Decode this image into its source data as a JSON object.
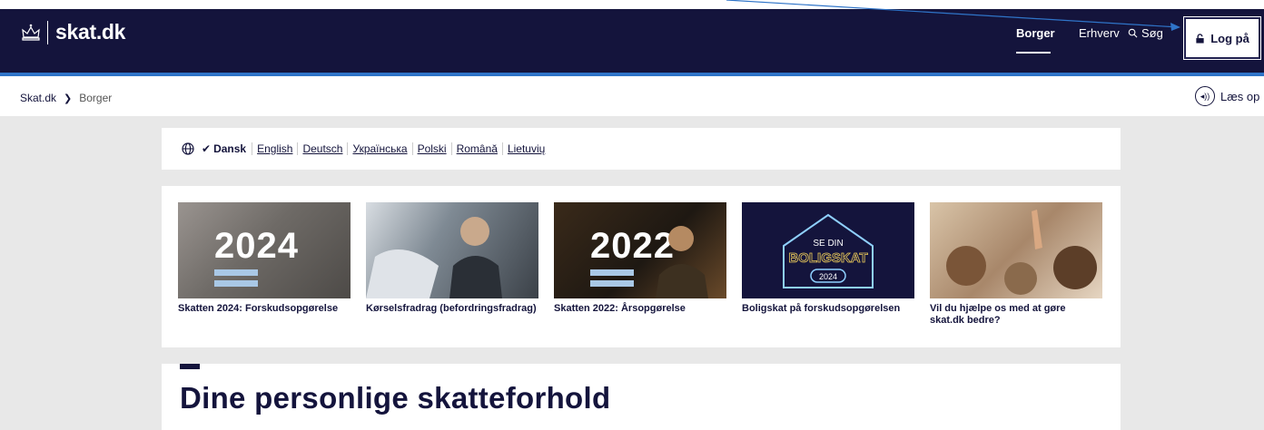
{
  "header": {
    "logo_text": "skat.dk",
    "nav": {
      "borger": "Borger",
      "erhverv": "Erhverv",
      "search": "Søg"
    },
    "login_label": "Log på"
  },
  "breadcrumb": {
    "home": "Skat.dk",
    "separator": "❯",
    "current": "Borger"
  },
  "read_aloud": {
    "icon_glyph": "◂))",
    "label": "Læs op"
  },
  "languages": {
    "active": "Dansk",
    "items": [
      "English",
      "Deutsch",
      "Українська",
      "Polski",
      "Română",
      "Lietuvių"
    ]
  },
  "cards": [
    {
      "caption": "Skatten 2024: Forskudsopgørelse",
      "overlay": "2024"
    },
    {
      "caption": "Kørselsfradrag (befordringsfradrag)"
    },
    {
      "caption": "Skatten 2022: Årsopgørelse",
      "overlay": "2022"
    },
    {
      "caption": "Boligskat på forskudsopgørelsen",
      "overlay_line1": "SE DIN",
      "overlay_line2": "BOLIGSKAT",
      "overlay_year": "2024"
    },
    {
      "caption": "Vil du hjælpe os med at gøre skat.dk bedre?"
    }
  ],
  "main": {
    "title": "Dine personlige skatteforhold"
  },
  "colors": {
    "navy": "#14143c",
    "accent": "#2f74c8",
    "gray_bg": "#e8e8e8",
    "bar_blue": "#a9c8e6"
  }
}
